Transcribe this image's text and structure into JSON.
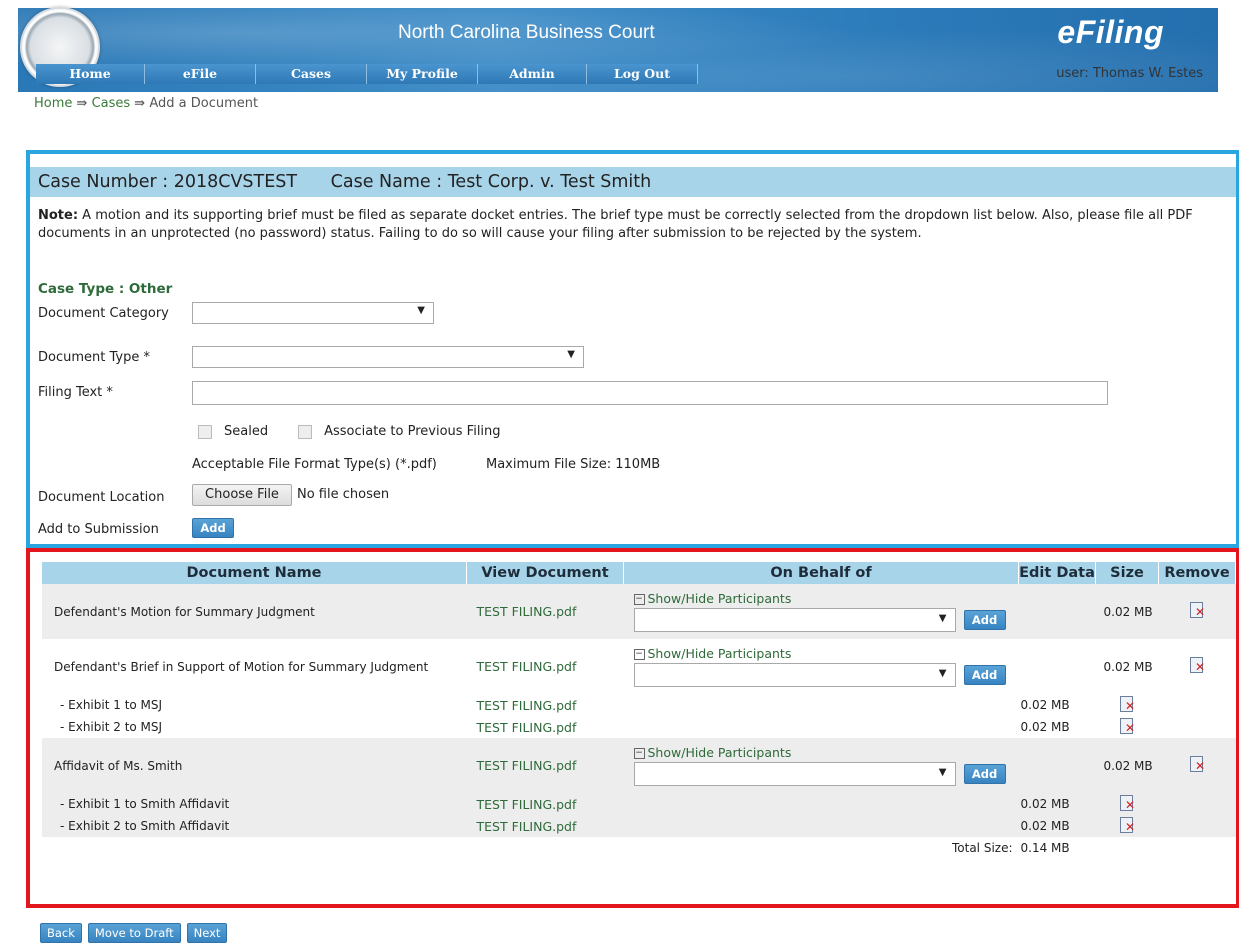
{
  "header": {
    "site_title": "North Carolina Business Court",
    "logo_text": "eFiling",
    "user_label": "user: Thomas W. Estes"
  },
  "nav": [
    "Home",
    "eFile",
    "Cases",
    "My Profile",
    "Admin",
    "Log Out"
  ],
  "breadcrumb": [
    "Home",
    "Cases",
    "Add a Document"
  ],
  "case": {
    "number_label": "Case Number : 2018CVSTEST",
    "name_label": "Case Name : Test Corp. v. Test Smith",
    "note_bold": "Note:",
    "note_text": " A motion and its supporting brief must be filed as separate docket entries. The brief type must be correctly selected from the dropdown list below. Also, please file all PDF documents in an unprotected (no password) status. Failing to do so will cause your filing after submission to be rejected by the system.",
    "case_type": "Case Type : Other"
  },
  "form": {
    "doc_category_label": "Document Category",
    "doc_category_value": "",
    "doc_type_label": "Document Type *",
    "doc_type_value": "",
    "filing_text_label": "Filing Text *",
    "filing_text_value": "",
    "sealed_label": "Sealed",
    "associate_label": "Associate to Previous Filing",
    "format_note": "Acceptable File Format Type(s) (*.pdf)",
    "max_size_note": "Maximum File Size: 110MB",
    "doc_location_label": "Document Location",
    "choose_file_label": "Choose File",
    "no_file_label": "No file chosen",
    "add_submission_label": "Add to Submission",
    "add_button": "Add"
  },
  "table": {
    "headers": [
      "Document Name",
      "View Document",
      "On Behalf of",
      "Edit Data",
      "Size",
      "Remove"
    ],
    "show_hide_label": "Show/Hide Participants",
    "add_button": "Add",
    "rows": [
      {
        "name": "Defendant's Motion for Summary Judgment",
        "file": "TEST FILING.pdf",
        "size": "0.02 MB"
      },
      {
        "name": "Defendant's Brief in Support of Motion for Summary Judgment",
        "file": "TEST FILING.pdf",
        "size": "0.02 MB"
      },
      {
        "name": "- Exhibit 1 to MSJ",
        "file": "TEST FILING.pdf",
        "size": "0.02 MB"
      },
      {
        "name": "- Exhibit 2 to MSJ",
        "file": "TEST FILING.pdf",
        "size": "0.02 MB"
      },
      {
        "name": "Affidavit of Ms. Smith",
        "file": "TEST FILING.pdf",
        "size": "0.02 MB"
      },
      {
        "name": "- Exhibit 1 to Smith Affidavit",
        "file": "TEST FILING.pdf",
        "size": "0.02 MB"
      },
      {
        "name": "- Exhibit 2 to Smith Affidavit",
        "file": "TEST FILING.pdf",
        "size": "0.02 MB"
      }
    ],
    "total_label": "Total Size:",
    "total_value": "0.14 MB"
  },
  "bottom_buttons": [
    "Back",
    "Move to Draft",
    "Next"
  ],
  "colors": {
    "accent": "#29a5e0",
    "table_border": "#e3161d",
    "header_blue": "#a8d4ea",
    "link_green": "#2e6a3a"
  }
}
